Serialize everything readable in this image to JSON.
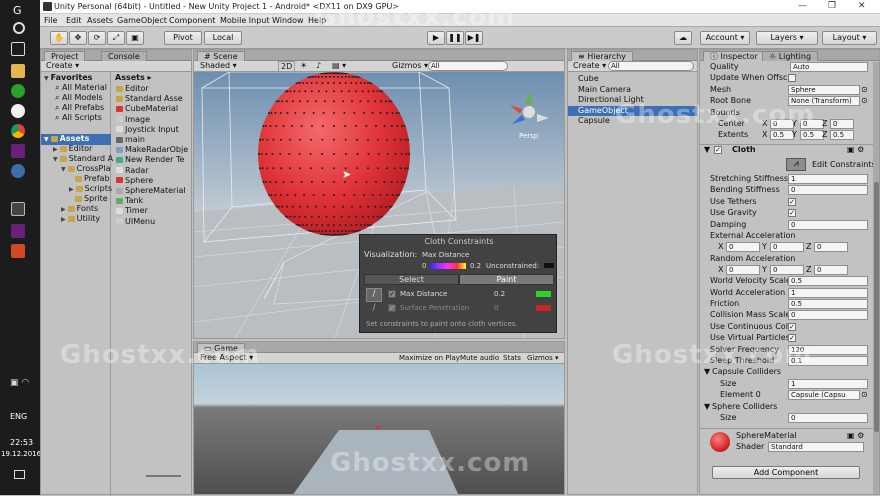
{
  "taskbar": {
    "time": "22:53",
    "date": "19.12.2016",
    "lang": "ENG",
    "search_label": "G",
    "cortana": "o"
  },
  "title": {
    "text": "Unity Personal (64bit) - Untitled - New Unity Project 1 - Android* <DX11 on DX9 GPU>",
    "min": "—",
    "max": "❐",
    "close": "✕"
  },
  "menu": [
    "File",
    "Edit",
    "Assets",
    "GameObject",
    "Component",
    "Mobile Input",
    "Window",
    "Help"
  ],
  "toolbar": {
    "pivot": "Pivot",
    "local": "Local",
    "account": "Account",
    "layers": "Layers",
    "layout": "Layout"
  },
  "project": {
    "tab1": "Project",
    "tab2": "Console",
    "create": "Create",
    "favorites": "Favorites",
    "fav_items": [
      "All Material",
      "All Models",
      "All Prefabs",
      "All Scripts"
    ],
    "assets_root": "Assets",
    "tree": [
      "Editor",
      "Standard A",
      "CrossPla",
      "Prefab",
      "Scripts",
      "Sprite",
      "Fonts",
      "Utility"
    ],
    "assets_header": "Assets",
    "asset_items": [
      "Editor",
      "Standard Asse",
      "CubeMaterial",
      "Image",
      "Joystick Input",
      "main",
      "MakeRadarObje",
      "New Render Te",
      "Radar",
      "Sphere",
      "SphereMaterial",
      "Tank",
      "Timer",
      "UIMenu"
    ]
  },
  "scene": {
    "tab": "Scene",
    "shading": "Shaded",
    "mode2d": "2D",
    "gizmos": "Gizmos",
    "search": "All",
    "persp": "Persp"
  },
  "cloth": {
    "title": "Cloth Constraints",
    "vis_label": "Visualization:",
    "vis_value": "Max Distance",
    "min": "0",
    "max": "0.2",
    "unconstrained": "Unconstrained:",
    "select": "Select",
    "paint": "Paint",
    "maxdist_label": "Max Distance",
    "maxdist_val": "0.2",
    "surf_label": "Surface Penetration",
    "surf_val": "0",
    "hint": "Set constraints to paint onto cloth vertices."
  },
  "game": {
    "tab": "Game",
    "aspect": "Free Aspect",
    "max_play": "Maximize on Play",
    "mute": "Mute audio",
    "stats": "Stats",
    "gizmos": "Gizmos"
  },
  "hierarchy": {
    "tab": "Hierarchy",
    "create": "Create",
    "search": "All",
    "items": [
      "Cube",
      "Main Camera",
      "Directional Light",
      "GameObject",
      "Capsule"
    ],
    "selected": 3
  },
  "inspector": {
    "tab1": "Inspector",
    "tab2": "Lighting",
    "rows": [
      {
        "l": "Quality",
        "v": "Auto",
        "type": "drop"
      },
      {
        "l": "Update When Offscre",
        "type": "chk",
        "c": ""
      },
      {
        "l": "Mesh",
        "v": "Sphere",
        "type": "obj"
      },
      {
        "l": "Root Bone",
        "v": "None (Transform)",
        "type": "obj"
      },
      {
        "l": "Bounds",
        "type": "none"
      }
    ],
    "center": {
      "l": "Center",
      "x": "0",
      "y": "0",
      "z": "0"
    },
    "extents": {
      "l": "Extents",
      "x": "0.5",
      "y": "0.5",
      "z": "0.5"
    },
    "cloth_header": "Cloth",
    "edit_constraints": "Edit Constraints",
    "cloth_rows": [
      {
        "l": "Stretching Stiffness",
        "v": "1"
      },
      {
        "l": "Bending Stiffness",
        "v": "0"
      },
      {
        "l": "Use Tethers",
        "c": "✓"
      },
      {
        "l": "Use Gravity",
        "c": "✓"
      },
      {
        "l": "Damping",
        "v": "0"
      },
      {
        "l": "External Acceleration",
        "v": ""
      }
    ],
    "ext_acc": {
      "x": "0",
      "y": "0",
      "z": "0"
    },
    "rand_label": "Random Acceleration",
    "rand_acc": {
      "x": "0",
      "y": "0",
      "z": "0"
    },
    "cloth_rows2": [
      {
        "l": "World Velocity Scale",
        "v": "0.5"
      },
      {
        "l": "World Acceleration S",
        "v": "1"
      },
      {
        "l": "Friction",
        "v": "0.5"
      },
      {
        "l": "Collision Mass Scale",
        "v": "0"
      },
      {
        "l": "Use Continuous Colli",
        "c": "✓"
      },
      {
        "l": "Use Virtual Particles",
        "c": "✓"
      },
      {
        "l": "Solver Frequency",
        "v": "120"
      },
      {
        "l": "Sleep Threshold",
        "v": "0.1"
      }
    ],
    "capsule_colliders": "Capsule Colliders",
    "size_label": "Size",
    "caps_size": "1",
    "element0": "Element 0",
    "element0_val": "Capsule (Capsu",
    "sphere_colliders": "Sphere Colliders",
    "sphere_size": "0",
    "material_name": "SphereMaterial",
    "shader_label": "Shader",
    "shader_val": "Standard",
    "add_component": "Add Component"
  },
  "watermark": "Ghostxx.com",
  "colors": {
    "sphere": "#e0353c",
    "selection": "#3d6fb4",
    "sky": "#8fb0cc",
    "ground": "#5a5a5a"
  }
}
